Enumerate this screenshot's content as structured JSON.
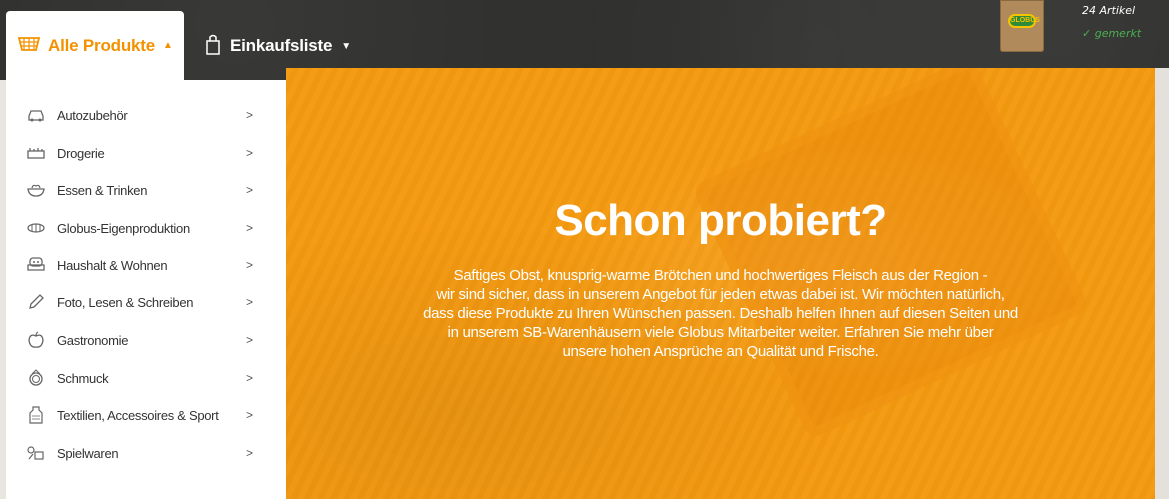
{
  "nav": {
    "active_tab": {
      "label": "Alle Produkte",
      "arrow": "▲",
      "icon": "basket-icon"
    },
    "list_tab": {
      "label": "Einkaufsliste",
      "arrow": "▼",
      "icon": "shopping-bag-icon"
    },
    "cart": {
      "count_text": "24 Artikel",
      "saved_text": "✓ gemerkt",
      "logo_text": "GLOBUS"
    }
  },
  "sidebar": {
    "items": [
      {
        "label": "Autozubehör",
        "icon": "car-icon",
        "chevron": ">"
      },
      {
        "label": "Drogerie",
        "icon": "toiletries-icon",
        "chevron": ">"
      },
      {
        "label": "Essen & Trinken",
        "icon": "bowl-icon",
        "chevron": ">"
      },
      {
        "label": "Globus-Eigenproduktion",
        "icon": "sausage-icon",
        "chevron": ">"
      },
      {
        "label": "Haushalt & Wohnen",
        "icon": "armchair-icon",
        "chevron": ">"
      },
      {
        "label": "Foto, Lesen & Schreiben",
        "icon": "pen-icon",
        "chevron": ">"
      },
      {
        "label": "Gastronomie",
        "icon": "apple-icon",
        "chevron": ">"
      },
      {
        "label": "Schmuck",
        "icon": "ring-icon",
        "chevron": ">"
      },
      {
        "label": "Textilien, Accessoires & Sport",
        "icon": "shirt-icon",
        "chevron": ">"
      },
      {
        "label": "Spielwaren",
        "icon": "toy-icon",
        "chevron": ">"
      }
    ]
  },
  "hero": {
    "title": "Schon probiert?",
    "lines": [
      "Saftiges Obst, knusprig-warme Brötchen und hochwertiges Fleisch aus der Region -",
      "wir sind sicher, dass in unserem Angebot für jeden etwas dabei ist. Wir möchten natürlich,",
      "dass diese Produkte zu Ihren Wünschen passen. Deshalb helfen Ihnen auf diesen Seiten und",
      "in unserem SB-Warenhäusern viele Globus Mitarbeiter weiter. Erfahren Sie mehr über",
      "unsere hohen Ansprüche an Qualität und Frische."
    ]
  },
  "colors": {
    "accent": "#f39200",
    "hero": "#f59a10",
    "topbar": "#2e2e2c",
    "saved": "#4caf50"
  }
}
